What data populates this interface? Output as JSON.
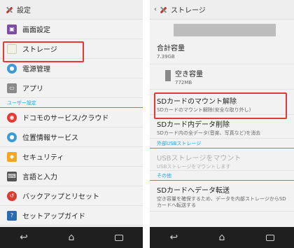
{
  "left": {
    "title": "設定",
    "items": [
      {
        "label": "画面設定",
        "icon": "display-icon",
        "color": "#7b4ea3"
      },
      {
        "label": "ストレージ",
        "icon": "storage-icon",
        "color": "#f1f1e4"
      },
      {
        "label": "電源管理",
        "icon": "battery-icon",
        "color": "#3a9bd5"
      },
      {
        "label": "アプリ",
        "icon": "apps-icon",
        "color": "#8a8a8a"
      }
    ],
    "section": "ユーザー設定",
    "items2": [
      {
        "label": "ドコモのサービス/クラウド",
        "icon": "docomo-icon",
        "color": "#e53935"
      },
      {
        "label": "位置情報サービス",
        "icon": "location-icon",
        "color": "#3a9bd5"
      },
      {
        "label": "セキュリティ",
        "icon": "lock-icon",
        "color": "#f5a623"
      },
      {
        "label": "言語と入力",
        "icon": "keyboard-icon",
        "color": "#555555"
      },
      {
        "label": "バックアップとリセット",
        "icon": "backup-icon",
        "color": "#d83b2f"
      },
      {
        "label": "セットアップガイド",
        "icon": "guide-icon",
        "color": "#2b6cb0"
      }
    ]
  },
  "right": {
    "title": "ストレージ",
    "total_label": "合計容量",
    "total_value": "7.39GB",
    "free_label": "空き容量",
    "free_value": "772MB",
    "unmount_label": "SDカードのマウント解除",
    "unmount_desc": "SDカードのマウント解除(安全な取り外し)",
    "erase_label": "SDカード内データ削除",
    "erase_desc": "SDカード内の全データ(音楽、写真など)を消去",
    "section_usb": "外部USBストレージ",
    "usb_mount_label": "USBストレージをマウント",
    "usb_mount_desc": "USBストレージをマウントします",
    "section_other": "その他",
    "transfer_label": "SDカードへデータ転送",
    "transfer_desc": "空き容量を確保するため、データを内部ストレージからSDカードへ転送する"
  },
  "nav": {
    "back_icon": "back-icon",
    "home_icon": "home-icon",
    "recent_icon": "recent-apps-icon"
  }
}
